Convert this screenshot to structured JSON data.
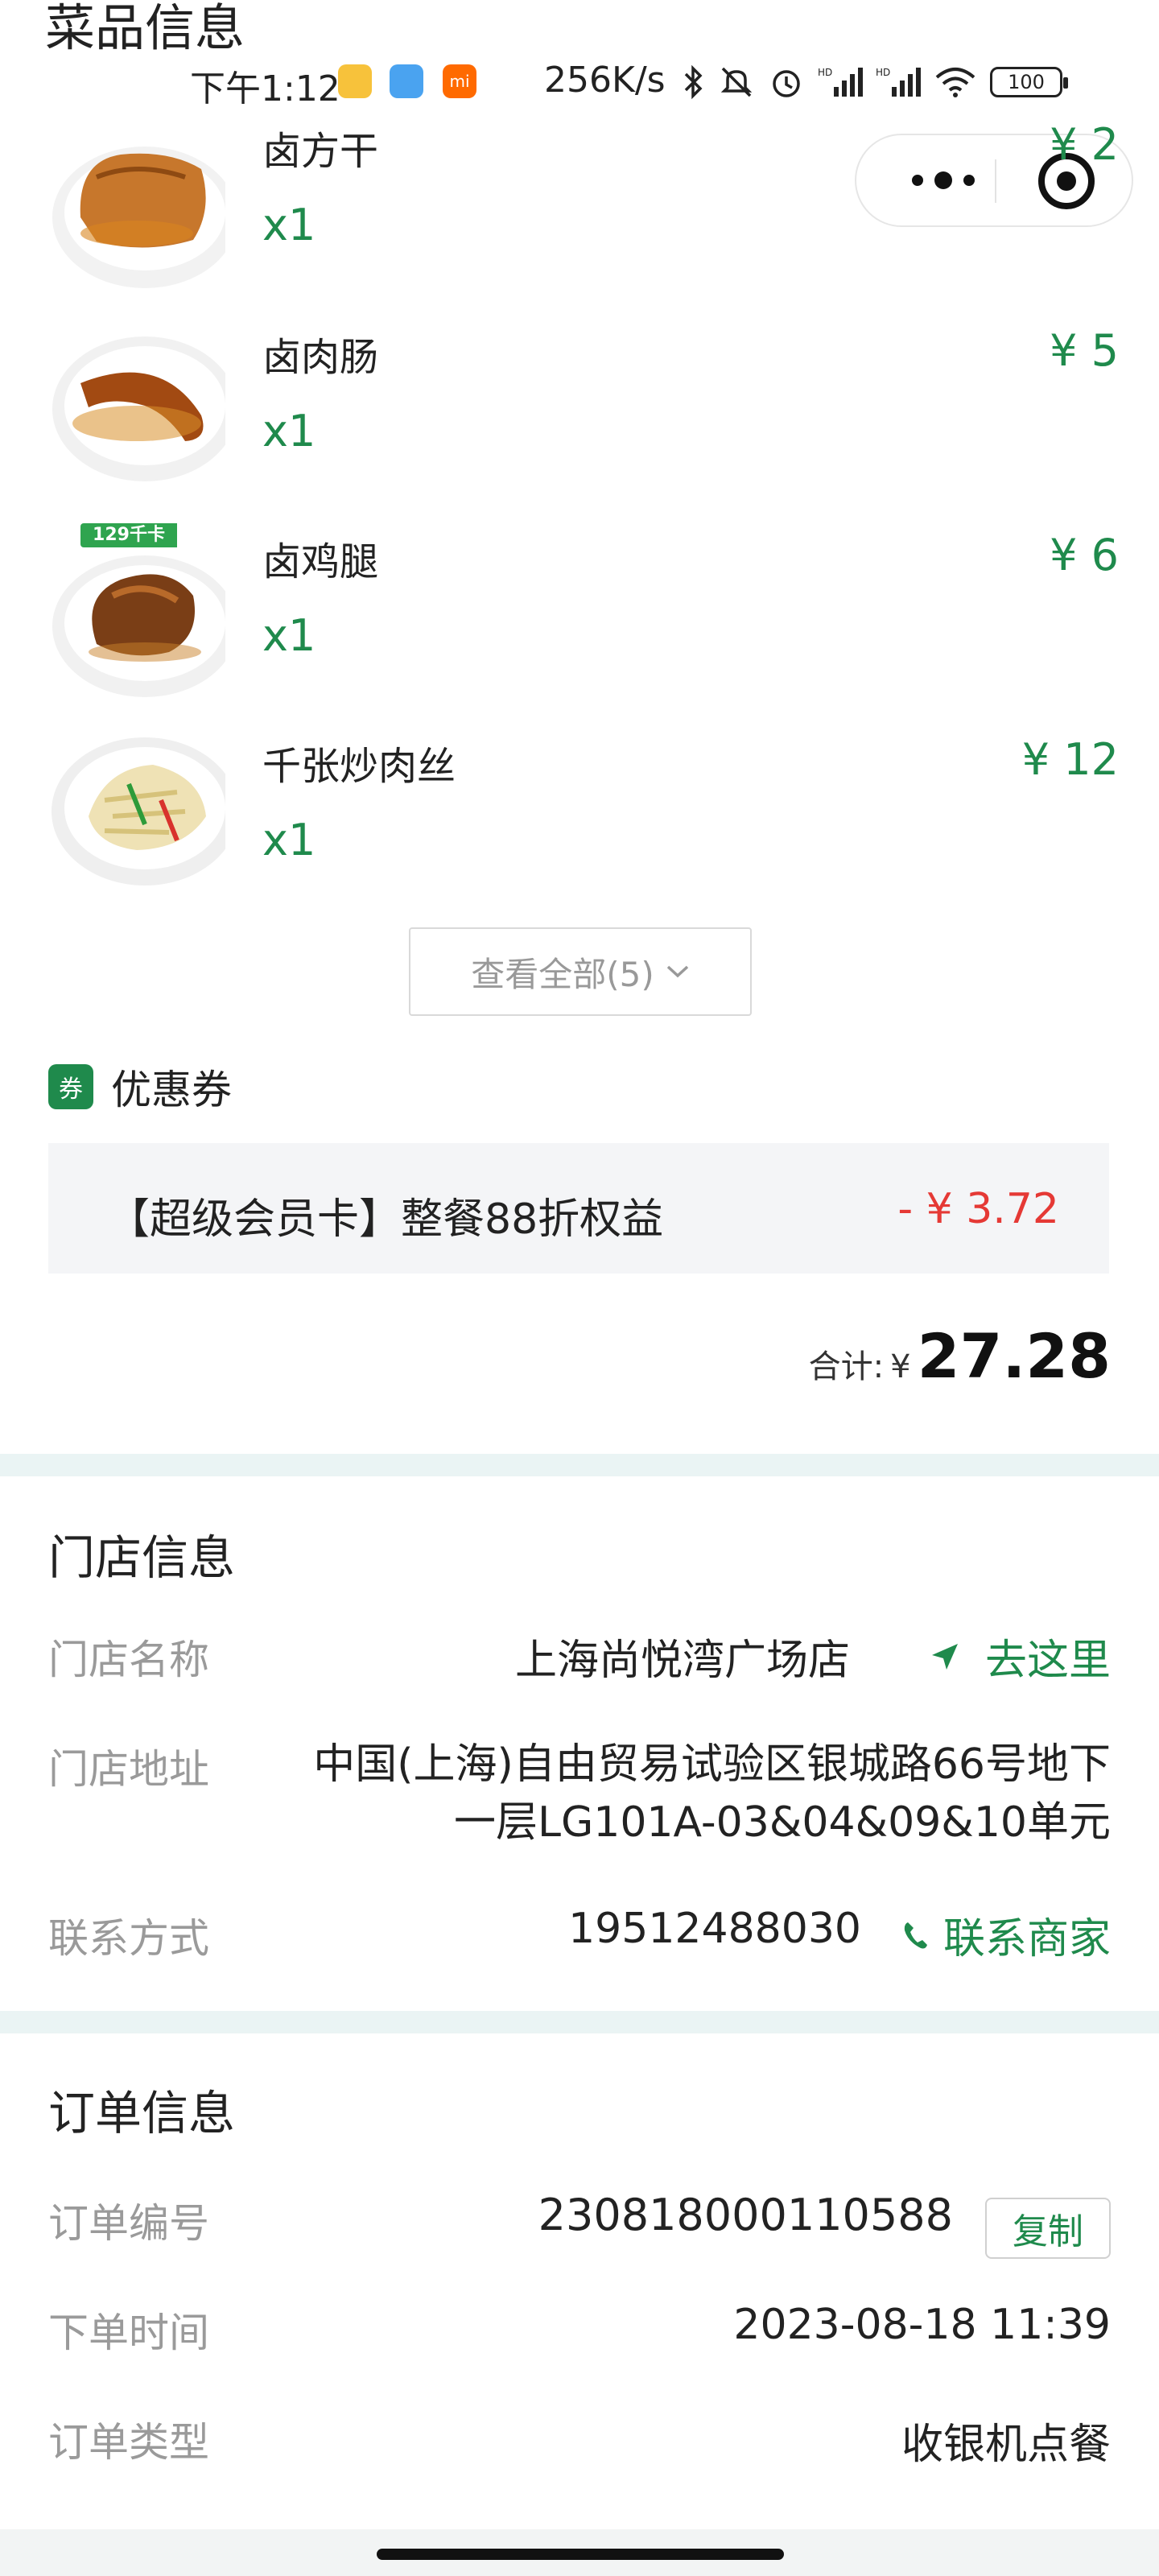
{
  "section_title": "菜品信息",
  "status_bar": {
    "time": "下午1:12",
    "net_speed": "256K/s",
    "battery": "100",
    "icons": [
      "app-icon-1",
      "app-icon-2",
      "app-icon-mi",
      "bluetooth-icon",
      "mute-icon",
      "alarm-icon",
      "signal-hd-icon",
      "signal-hd-icon",
      "wifi-icon",
      "battery-icon"
    ]
  },
  "capsule": {
    "more_icon": "more-dots-icon",
    "close_icon": "target-circle-icon"
  },
  "dishes": [
    {
      "name": "卤方干",
      "qty": "x1",
      "price": "¥ 2",
      "tag": ""
    },
    {
      "name": "卤肉肠",
      "qty": "x1",
      "price": "¥ 5",
      "tag": ""
    },
    {
      "name": "卤鸡腿",
      "qty": "x1",
      "price": "¥ 6",
      "tag": "129千卡"
    },
    {
      "name": "千张炒肉丝",
      "qty": "x1",
      "price": "¥ 12",
      "tag": ""
    }
  ],
  "view_all": {
    "label": "查看全部(5)",
    "icon": "chevron-down-icon"
  },
  "coupon": {
    "badge": "券",
    "title": "优惠券",
    "item_label": "【超级会员卡】整餐88折权益",
    "item_amount": "- ¥ 3.72"
  },
  "total": {
    "label": "合计:",
    "symbol": "¥",
    "value": "27.28"
  },
  "store_info": {
    "title": "门店信息",
    "name_label": "门店名称",
    "name_value": "上海尚悦湾广场店",
    "goto_label": "去这里",
    "address_label": "门店地址",
    "address_value": "中国(上海)自由贸易试验区银城路66号地下一层LG101A-03&04&09&10单元",
    "contact_label": "联系方式",
    "phone": "19512488030",
    "contact_button": "联系商家"
  },
  "order_info": {
    "title": "订单信息",
    "number_label": "订单编号",
    "number_value": "230818000110588",
    "copy_label": "复制",
    "time_label": "下单时间",
    "time_value": "2023-08-18 11:39",
    "type_label": "订单类型",
    "type_value": "收银机点餐"
  },
  "colors": {
    "accent": "#1f8a4c",
    "discount": "#e53935",
    "band": "#eaf4f4"
  }
}
